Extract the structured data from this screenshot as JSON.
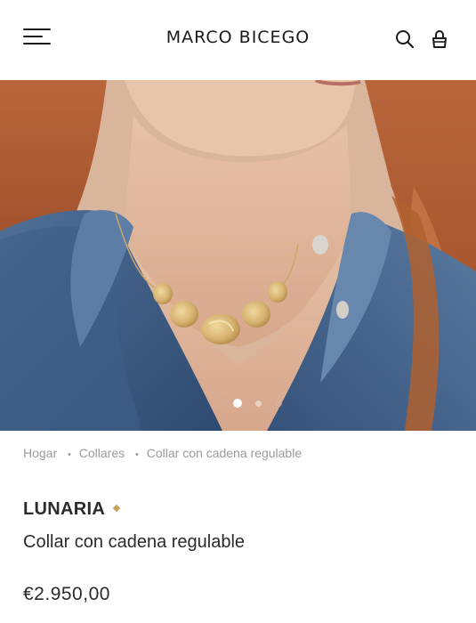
{
  "header": {
    "brand": "MARCO BICEGO",
    "icons": {
      "menu": "hamburger-menu-icon",
      "search": "search-icon",
      "bag": "shopping-bag-icon"
    }
  },
  "hero": {
    "image_alt": "Modelo con collar Lunaria de oro y camisa vaquera",
    "carousel": {
      "total": 3,
      "active": 1
    }
  },
  "breadcrumb": {
    "items": [
      "Hogar",
      "Collares",
      "Collar con cadena regulable"
    ]
  },
  "product": {
    "collection": "LUNARIA",
    "name": "Collar con cadena regulable",
    "price": "€2.950,00"
  },
  "colors": {
    "accent_gold": "#c6a15b",
    "text": "#2b2b2b",
    "muted": "#9a9a9a"
  }
}
